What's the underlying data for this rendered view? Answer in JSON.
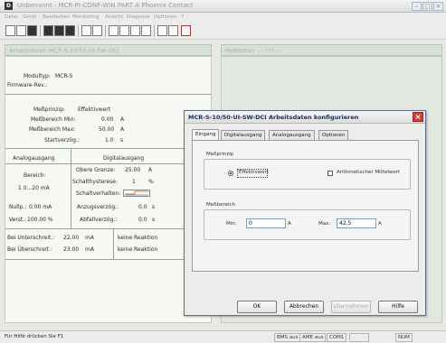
{
  "app": {
    "icon_letter": "D",
    "title": "Unbenannt - MCR-PI-CONF-WIN PART A Phoenix Contact"
  },
  "menu": [
    "Datei",
    "Gerät",
    "Bearbeiten",
    "Monitoring",
    "Ansicht",
    "Diagnose",
    "Optionen",
    "?"
  ],
  "toolbar": {
    "icons": [
      "new-file-icon",
      "open-folder-icon",
      "save-icon",
      "print-icon",
      "upload-icon",
      "download-icon",
      "copy-icon",
      "monitor-icon",
      "layout-icon",
      "grid-icon",
      "window-icon",
      "zoom-icon",
      "pointer-icon",
      "help-icon",
      "red-app-icon"
    ]
  },
  "left_panel": {
    "header": "Arbeitsdaten    MCR-S-10/50-UI-SW-DCI",
    "module_label": "Modultyp:",
    "module_value": "MCR-S",
    "firmware_label": "Firmware-Rev.:",
    "firmware_value": "",
    "measure": {
      "principle_label": "Meßprinzip:",
      "principle_value": "Effektivwert",
      "min_label": "Meßbereich Min:",
      "min_value": "0.00",
      "min_unit": "A",
      "max_label": "Meßbereich Max:",
      "max_value": "50.00",
      "max_unit": "A",
      "start_label": "Startverzög.:",
      "start_value": "1.0",
      "start_unit": "s"
    },
    "analog": {
      "title": "Analogausgang",
      "range_label": "Bereich:",
      "range_value": "1 0...20 mA",
      "zero_label": "Nullp.:",
      "zero_value": "0.00 mA",
      "gain_label": "Verst.:",
      "gain_value": "100.00 %"
    },
    "digital": {
      "title": "Digitalausgang",
      "upper_label": "Obere Grenze:",
      "upper_value": "25.00",
      "upper_unit": "A",
      "hyst_label": "Schalthysterese:",
      "hyst_value": "1",
      "hyst_unit": "%",
      "behaviour_label": "Schaltverhalten:",
      "delay_on_label": "Anzugsverzög.:",
      "delay_on_value": "0.0",
      "delay_on_unit": "s",
      "delay_off_label": "Abfallverzög.:",
      "delay_off_value": "0.0",
      "delay_off_unit": "s"
    },
    "under": {
      "label": "Bei Unterschreit.:",
      "value": "22.00",
      "unit": "mA",
      "reaction": "keine Reaktion"
    },
    "over": {
      "label": "Bei Überschreit.:",
      "value": "23.00",
      "unit": "mA",
      "reaction": "keine Reaktion"
    }
  },
  "right_panel": {
    "header": "Meßdaten    --- ??? ---"
  },
  "dialog": {
    "title": "MCR-S-10/50-UI-SW-DCI  Arbeitsdaten konfigurieren",
    "tabs": [
      "Eingang",
      "Digitalausgang",
      "Analogausgang",
      "Optionen"
    ],
    "active_tab": 0,
    "principle_group": "Meßprinzip",
    "radio_rms": "Effektivwert",
    "radio_rms_selected": true,
    "check_mean": "Arithmetischer Mittelwert",
    "check_mean_checked": false,
    "range_group": "Meßbereich",
    "min_label": "Min:",
    "min_value": "0",
    "min_unit": "A",
    "max_label": "Max:",
    "max_value": "42.5",
    "max_unit": "A",
    "buttons": {
      "ok": "OK",
      "cancel": "Abbrechen",
      "apply": "Übernehmen",
      "help": "Hilfe"
    }
  },
  "status": {
    "help": "Für Hilfe drücken Sie F1",
    "bms": "BMS aus",
    "ame": "AME aus",
    "com": "COM1",
    "num": "NUM"
  }
}
